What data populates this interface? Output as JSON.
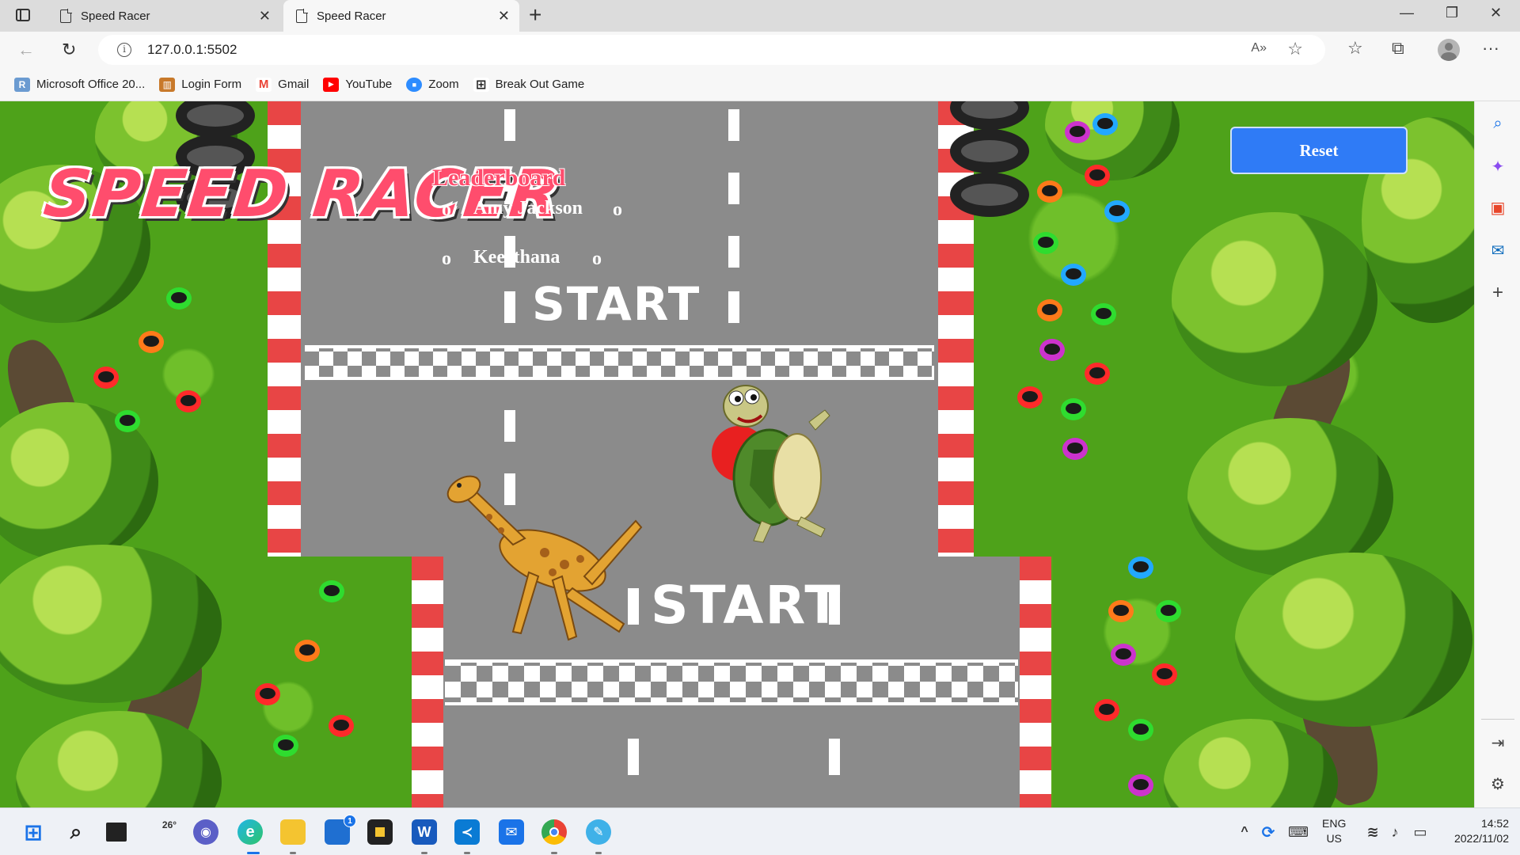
{
  "browser": {
    "tabs": [
      {
        "title": "Speed Racer",
        "active": false
      },
      {
        "title": "Speed Racer",
        "active": true
      }
    ],
    "url": "127.0.0.1:5502",
    "bookmarks": [
      {
        "label": "Microsoft Office 20...",
        "icon": "office-r-icon",
        "color": "#6b9bd1"
      },
      {
        "label": "Login Form",
        "icon": "login-form-icon",
        "color": "#c8792a"
      },
      {
        "label": "Gmail",
        "icon": "gmail-icon",
        "color": "#ea4335"
      },
      {
        "label": "YouTube",
        "icon": "youtube-icon",
        "color": "#ff0000"
      },
      {
        "label": "Zoom",
        "icon": "zoom-icon",
        "color": "#2d8cff"
      },
      {
        "label": "Break Out Game",
        "icon": "grid-icon",
        "color": "#222222"
      }
    ]
  },
  "game": {
    "title": "SPEED RACER",
    "leaderboard_title": "Leaderboard",
    "leaderboard": [
      {
        "bullet_left": "o",
        "name": "Amy Jackson",
        "bullet_right": "o"
      },
      {
        "bullet_left": "o",
        "name": "Keerthana",
        "bullet_right": "o"
      }
    ],
    "reset_label": "Reset",
    "top_lane_text": "START",
    "bottom_lane_text": "START",
    "colors": {
      "accent": "#2f7bf6",
      "title": "#ff4d6d",
      "grass": "#4ea21a",
      "road": "#8b8b8b"
    }
  },
  "sidebar": {
    "icons": [
      "search-icon",
      "copilot-icon",
      "office-icon",
      "outlook-icon",
      "add-icon",
      "split-screen-icon",
      "settings-icon"
    ]
  },
  "taskbar": {
    "weather_temp": "26°",
    "store_badge": "1",
    "language": "ENG",
    "region": "US",
    "time": "14:52",
    "date": "2022/11/02"
  }
}
